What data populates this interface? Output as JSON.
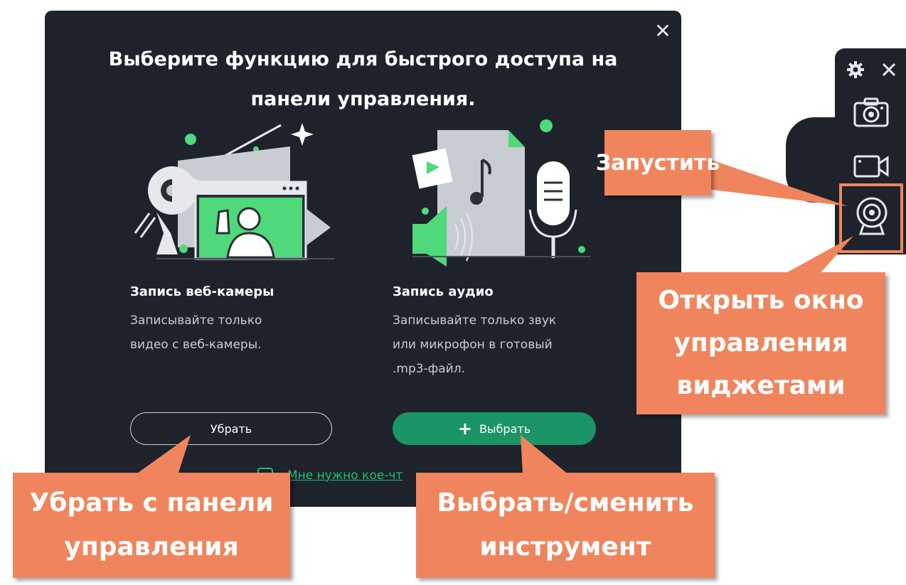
{
  "dialog": {
    "title_line1": "Выберите функцию для быстрого доступа на",
    "title_line2": "панели управления.",
    "close_icon": "close-icon",
    "cards": [
      {
        "title": "Запись веб-камеры",
        "desc_lines": [
          "Записывайте только",
          "видео с веб-камеры."
        ],
        "illustration": "webcam-illustration"
      },
      {
        "title": "Запись аудио",
        "desc_lines": [
          "Записывайте только звук",
          "или микрофон в готовый",
          ".mp3-файл."
        ],
        "illustration": "audio-illustration"
      }
    ],
    "remove_button": "Убрать",
    "choose_button": "Выбрать",
    "need_link_text": "Мне нужно кое-чт"
  },
  "toolbar": {
    "icons": [
      "gear-icon",
      "close-icon",
      "screenshot-camera-icon",
      "video-camera-icon",
      "webcam-icon"
    ]
  },
  "callouts": {
    "launch": "Запустить",
    "widgets_line1": "Открыть окно",
    "widgets_line2": "управления",
    "widgets_line3": "виджетами",
    "remove_line1": "Убрать с панели",
    "remove_line2": "управления",
    "change_line1": "Выбрать/сменить",
    "change_line2": "инструмент"
  },
  "colors": {
    "dialog_bg": "#1e222b",
    "accent_green": "#1b9466",
    "link_green": "#1fbf7a",
    "illustration_green": "#4fd97a",
    "callout_orange": "#f0855d"
  }
}
